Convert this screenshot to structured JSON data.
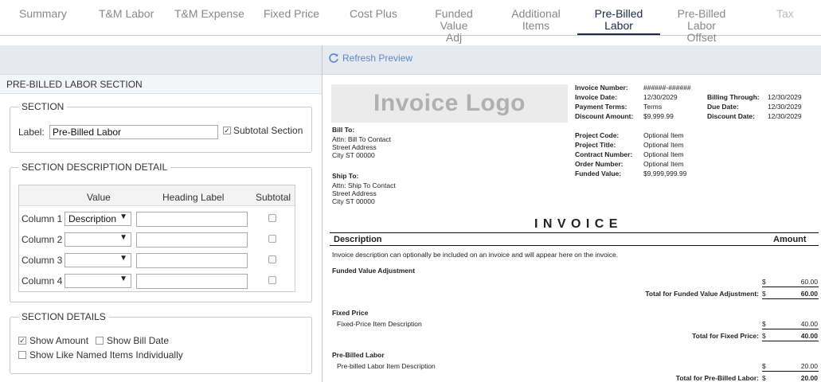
{
  "tabs": [
    {
      "label": "Summary"
    },
    {
      "label": "T&M Labor"
    },
    {
      "label": "T&M Expense"
    },
    {
      "label": "Fixed Price"
    },
    {
      "label": "Cost Plus"
    },
    {
      "label_1": "Funded Value",
      "label_2": "Adj"
    },
    {
      "label_1": "Additional",
      "label_2": "Items"
    },
    {
      "label_1": "Pre-Billed",
      "label_2": "Labor"
    },
    {
      "label_1": "Pre-Billed",
      "label_2": "Labor Offset"
    },
    {
      "label": "Tax"
    }
  ],
  "left": {
    "title": "PRE-BILLED LABOR SECTION",
    "section": {
      "legend": "SECTION",
      "label_text": "Label:",
      "label_value": "Pre-Billed Labor",
      "subtotal_text": "Subtotal Section"
    },
    "desc": {
      "legend": "SECTION DESCRIPTION DETAIL",
      "headers": {
        "value": "Value",
        "heading": "Heading Label",
        "subtotal": "Subtotal"
      },
      "rows": [
        {
          "label": "Column 1",
          "value": "Description"
        },
        {
          "label": "Column 2",
          "value": ""
        },
        {
          "label": "Column 3",
          "value": ""
        },
        {
          "label": "Column 4",
          "value": ""
        }
      ]
    },
    "details": {
      "legend": "SECTION DETAILS",
      "show_amount": "Show Amount",
      "show_bill_date": "Show Bill Date",
      "show_like": "Show Like Named Items Individually"
    }
  },
  "right": {
    "refresh": "Refresh Preview",
    "logo": "Invoice Logo",
    "meta_left": [
      {
        "k": "Invoice Number:",
        "v": "######-######"
      },
      {
        "k": "Invoice Date:",
        "v": "12/30/2029"
      },
      {
        "k": "Payment Terms:",
        "v": "Terms"
      },
      {
        "k": "Discount Amount:",
        "v": "$9,999.99"
      }
    ],
    "meta_right": [
      {
        "k": "Billing Through:",
        "v": "12/30/2029"
      },
      {
        "k": "Due Date:",
        "v": "12/30/2029"
      },
      {
        "k": "Discount Date:",
        "v": "12/30/2029"
      }
    ],
    "bill_to": {
      "title": "Bill To:",
      "l1": "Attn: Bill To Contact",
      "l2": "Street Address",
      "l3": "City ST 00000"
    },
    "ship_to": {
      "title": "Ship To:",
      "l1": "Attn: Ship To Contact",
      "l2": "Street Address",
      "l3": "City ST 00000"
    },
    "project": [
      {
        "k": "Project Code:",
        "v": "Optional Item"
      },
      {
        "k": "Project Title:",
        "v": "Optional Item"
      },
      {
        "k": "Contract Number:",
        "v": "Optional Item"
      },
      {
        "k": "Order Number:",
        "v": "Optional Item"
      },
      {
        "k": "Funded Value:",
        "v": "$9,999,999.99"
      }
    ],
    "invoice_title": "I N V O I C E",
    "col_desc": "Description",
    "col_amount": "Amount",
    "intro": "Invoice description can optionally be included on an invoice and will appear here on the invoice.",
    "fva": {
      "title": "Funded Value Adjustment",
      "cur": "$",
      "amount": "60.00",
      "total_label": "Total for Funded Value Adjustment:",
      "total": "60.00"
    },
    "fixed": {
      "title": "Fixed Price",
      "item": "Fixed-Price Item Description",
      "cur": "$",
      "amount": "40.00",
      "total_label": "Total for Fixed Price:",
      "total": "40.00"
    },
    "pbl": {
      "title": "Pre-Billed Labor",
      "item": "Pre-billed Labor Item Description",
      "cur": "$",
      "amount": "20.00",
      "total_label": "Total for Pre-Billed Labor:",
      "total": "20.00"
    }
  }
}
